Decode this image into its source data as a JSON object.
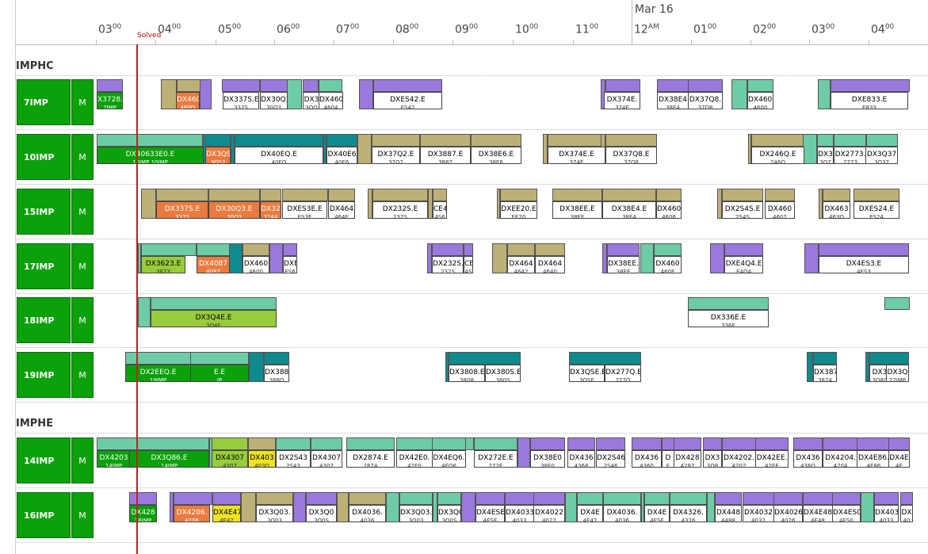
{
  "timeline": {
    "date_label": "Mar 16",
    "hours": [
      {
        "h": "03",
        "m": "00"
      },
      {
        "h": "04",
        "m": "00"
      },
      {
        "h": "05",
        "m": "00"
      },
      {
        "h": "06",
        "m": "00"
      },
      {
        "h": "07",
        "m": "00"
      },
      {
        "h": "08",
        "m": "00"
      },
      {
        "h": "09",
        "m": "00"
      },
      {
        "h": "10",
        "m": "00"
      },
      {
        "h": "11",
        "m": "00"
      },
      {
        "h": "12",
        "m": "AM"
      },
      {
        "h": "01",
        "m": "00"
      },
      {
        "h": "02",
        "m": "00"
      },
      {
        "h": "03",
        "m": "00"
      },
      {
        "h": "04",
        "m": "00"
      }
    ],
    "now_label": "Solved"
  },
  "colors": {
    "purple": "#9a79de",
    "tan": "#bdb076",
    "green": "#0aa10a",
    "mint": "#6dcca5",
    "teal": "#0f8a8d",
    "orange": "#ea7b3f",
    "lime": "#97cc3c",
    "yellow": "#efe322",
    "now": "#b22222"
  },
  "groups": [
    {
      "name": "IMPHC",
      "rows": [
        {
          "name": "7IMP",
          "mode": "M",
          "tasks": [
            {
              "c": "green",
              "t": "X3728.",
              "s": "7IMP"
            },
            {
              "c": "orange",
              "t": "DX460",
              "s": "460Q"
            },
            {
              "c": "white",
              "t": "DX337S.E",
              "s": "337S"
            },
            {
              "c": "white",
              "t": "DX30Q3",
              "s": "30Q3"
            },
            {
              "c": "white",
              "t": "DX3",
              "s": "3QQ"
            },
            {
              "c": "white",
              "t": "DX4604",
              "s": "4604"
            },
            {
              "c": "white",
              "t": "DXES42.E",
              "s": "ES42"
            },
            {
              "c": "white",
              "t": "DX374E.",
              "s": "374E"
            },
            {
              "c": "white",
              "t": "DX38E4",
              "s": "38E4"
            },
            {
              "c": "white",
              "t": "DX37Q8.",
              "s": "37Q8"
            },
            {
              "c": "white",
              "t": "DX4600",
              "s": "4600"
            },
            {
              "c": "white",
              "t": "DXE833.E",
              "s": "E833"
            }
          ]
        },
        {
          "name": "10IMP",
          "mode": "M",
          "tasks": [
            {
              "c": "green",
              "t": "DX40633E0.E",
              "s": "10IMP 10IMP"
            },
            {
              "c": "orange",
              "t": "DX3QS",
              "s": "3QS2"
            },
            {
              "c": "white",
              "t": "DX40EQ.E",
              "s": "40EQ"
            },
            {
              "c": "white",
              "t": "DX40E6",
              "s": "40E6"
            },
            {
              "c": "white",
              "t": "DX37Q2.E",
              "s": "37Q2"
            },
            {
              "c": "white",
              "t": "DX3887.E",
              "s": "3887"
            },
            {
              "c": "white",
              "t": "DX38E6.E",
              "s": "38E6"
            },
            {
              "c": "white",
              "t": "DX374E.E",
              "s": "374E"
            },
            {
              "c": "white",
              "t": "DX37Q8.E",
              "s": "37Q8"
            },
            {
              "c": "white",
              "t": "DX246Q.E",
              "s": "246Q"
            },
            {
              "c": "white",
              "t": "DX3",
              "s": "3Q7"
            },
            {
              "c": "white",
              "t": "DX2773.",
              "s": "2773"
            },
            {
              "c": "white",
              "t": "DX3Q37",
              "s": "3Q37"
            }
          ]
        },
        {
          "name": "15IMP",
          "mode": "M",
          "tasks": [
            {
              "c": "orange",
              "t": "DX337S.E",
              "s": "337S"
            },
            {
              "c": "orange",
              "t": "DX30Q3.E",
              "s": "30Q3"
            },
            {
              "c": "orange",
              "t": "DX32",
              "s": "3244"
            },
            {
              "c": "white",
              "t": "DXES3E.E",
              "s": "ES3E"
            },
            {
              "c": "white",
              "t": "DX464",
              "s": "464E"
            },
            {
              "c": "white",
              "t": "DX232S.E",
              "s": "232S"
            },
            {
              "c": "white",
              "t": "CE4",
              "s": "4S6"
            },
            {
              "c": "white",
              "t": "DXEE20.E",
              "s": "EE20"
            },
            {
              "c": "white",
              "t": "DX38EE.E",
              "s": "38EE"
            },
            {
              "c": "white",
              "t": "DX38E4.E",
              "s": "38E4"
            },
            {
              "c": "white",
              "t": "DX460",
              "s": "4606"
            },
            {
              "c": "white",
              "t": "DX2S4S.E",
              "s": "2S4S"
            },
            {
              "c": "white",
              "t": "DX460",
              "s": "4602"
            },
            {
              "c": "white",
              "t": "DX463",
              "s": "463Q"
            },
            {
              "c": "white",
              "t": "DXES24.E",
              "s": "ES24"
            }
          ]
        },
        {
          "name": "17IMP",
          "mode": "M",
          "tasks": [
            {
              "c": "lime",
              "t": "DX3623.E",
              "s": "3623"
            },
            {
              "c": "orange",
              "t": "DX4087",
              "s": "4087"
            },
            {
              "c": "white",
              "t": "DX460",
              "s": "4600"
            },
            {
              "c": "white",
              "t": "DXE",
              "s": "ES6"
            },
            {
              "c": "white",
              "t": "DX232S.",
              "s": "232S"
            },
            {
              "c": "white",
              "t": "CE",
              "s": "4S"
            },
            {
              "c": "white",
              "t": "DX464",
              "s": "4642"
            },
            {
              "c": "white",
              "t": "DX464",
              "s": "4640"
            },
            {
              "c": "white",
              "t": "DX38EE.",
              "s": "38EE"
            },
            {
              "c": "white",
              "t": "DX460",
              "s": "460E"
            },
            {
              "c": "white",
              "t": "DXE4Q4.E",
              "s": "E4Q4"
            },
            {
              "c": "white",
              "t": "DX4ES3.E",
              "s": "4ES3"
            }
          ]
        },
        {
          "name": "18IMP",
          "mode": "M",
          "tasks": [
            {
              "c": "lime",
              "t": "DX3Q4E.E",
              "s": "3Q4E"
            },
            {
              "c": "white",
              "t": "DX336E.E",
              "s": "336E"
            }
          ]
        },
        {
          "name": "19IMP",
          "mode": "M",
          "tasks": [
            {
              "c": "green",
              "t": "DX2EEQ.E",
              "s": "19IMP"
            },
            {
              "c": "green",
              "t": "E.E",
              "s": "IP"
            },
            {
              "c": "white",
              "t": "DX388",
              "s": "388Q"
            },
            {
              "c": "white",
              "t": "DX3808.E",
              "s": "3808"
            },
            {
              "c": "white",
              "t": "DX380S.E",
              "s": "380S"
            },
            {
              "c": "white",
              "t": "DX3QSE.E",
              "s": "3QSE"
            },
            {
              "c": "white",
              "t": "DX277Q.E",
              "s": "277Q"
            },
            {
              "c": "white",
              "t": "DX387",
              "s": "3874"
            },
            {
              "c": "white",
              "t": "DX3",
              "s": "3Q80"
            },
            {
              "c": "white",
              "t": "DX3Q",
              "s": "22IMP"
            }
          ]
        }
      ]
    },
    {
      "name": "IMPHE",
      "rows": [
        {
          "name": "14IMP",
          "mode": "M",
          "tasks": [
            {
              "c": "green",
              "t": "DX4203",
              "s": "14IMP"
            },
            {
              "c": "green",
              "t": "DX3Q86.E",
              "s": "14IMP"
            },
            {
              "c": "lime",
              "t": "DX4307",
              "s": "4307"
            },
            {
              "c": "yellow",
              "t": "DX403",
              "s": "403Q"
            },
            {
              "c": "white",
              "t": "DX2S43",
              "s": "2S43"
            },
            {
              "c": "white",
              "t": "DX4307",
              "s": "4307"
            },
            {
              "c": "white",
              "t": "DX2874.E",
              "s": "2874"
            },
            {
              "c": "white",
              "t": "DX42E0.",
              "s": "42E0"
            },
            {
              "c": "white",
              "t": "DX4EQ6.",
              "s": "4EQ6"
            },
            {
              "c": "white",
              "t": "DX272E.E",
              "s": "272E"
            },
            {
              "c": "white",
              "t": "DX38E0",
              "s": "38E0"
            },
            {
              "c": "white",
              "t": "DX436",
              "s": "4368"
            },
            {
              "c": "white",
              "t": "DX2S46",
              "s": "2S46"
            },
            {
              "c": "white",
              "t": "DX436",
              "s": "4360"
            },
            {
              "c": "white",
              "t": "D",
              "s": "E"
            },
            {
              "c": "white",
              "t": "DX428",
              "s": "4287"
            },
            {
              "c": "white",
              "t": "DX3",
              "s": "3Q8"
            },
            {
              "c": "white",
              "t": "DX4202.",
              "s": "4202"
            },
            {
              "c": "white",
              "t": "DX42EE.",
              "s": "42EE"
            },
            {
              "c": "white",
              "t": "DX436",
              "s": "436Q"
            },
            {
              "c": "white",
              "t": "DX4204.",
              "s": "4204"
            },
            {
              "c": "white",
              "t": "DX4E86.",
              "s": "4E86"
            },
            {
              "c": "white",
              "t": "DX4E",
              "s": "4E"
            }
          ]
        },
        {
          "name": "16IMP",
          "mode": "M",
          "tasks": [
            {
              "c": "green",
              "t": "DX428",
              "s": "16IMP"
            },
            {
              "c": "orange",
              "t": "DX4206.",
              "s": "4206"
            },
            {
              "c": "yellow",
              "t": "DX4E47",
              "s": "4E47"
            },
            {
              "c": "white",
              "t": "DX3Q03.",
              "s": "3Q03"
            },
            {
              "c": "white",
              "t": "DX3Q0",
              "s": "3Q0S"
            },
            {
              "c": "white",
              "t": "DX4036.",
              "s": "4036"
            },
            {
              "c": "white",
              "t": "DX3Q03.",
              "s": "3Q03"
            },
            {
              "c": "white",
              "t": "DX3Q0",
              "s": "3Q0S"
            },
            {
              "c": "white",
              "t": "DX4ESE",
              "s": "4ESE"
            },
            {
              "c": "white",
              "t": "DX4033",
              "s": "4033"
            },
            {
              "c": "white",
              "t": "DX4022",
              "s": "4022"
            },
            {
              "c": "white",
              "t": "DX4E",
              "s": "4E47"
            },
            {
              "c": "white",
              "t": "DX4036.",
              "s": "4036"
            },
            {
              "c": "white",
              "t": "DX4E",
              "s": "4ESE"
            },
            {
              "c": "white",
              "t": "DX4326.",
              "s": "4326"
            },
            {
              "c": "white",
              "t": "DX448",
              "s": "4488"
            },
            {
              "c": "white",
              "t": "DX4032",
              "s": "4032"
            },
            {
              "c": "white",
              "t": "DX4026",
              "s": "4026"
            },
            {
              "c": "white",
              "t": "DX4E48",
              "s": "4E48"
            },
            {
              "c": "white",
              "t": "DX4ES0",
              "s": "4ES0"
            },
            {
              "c": "white",
              "t": "DX403",
              "s": "4033"
            },
            {
              "c": "white",
              "t": "DX",
              "s": "40"
            }
          ]
        }
      ]
    }
  ]
}
